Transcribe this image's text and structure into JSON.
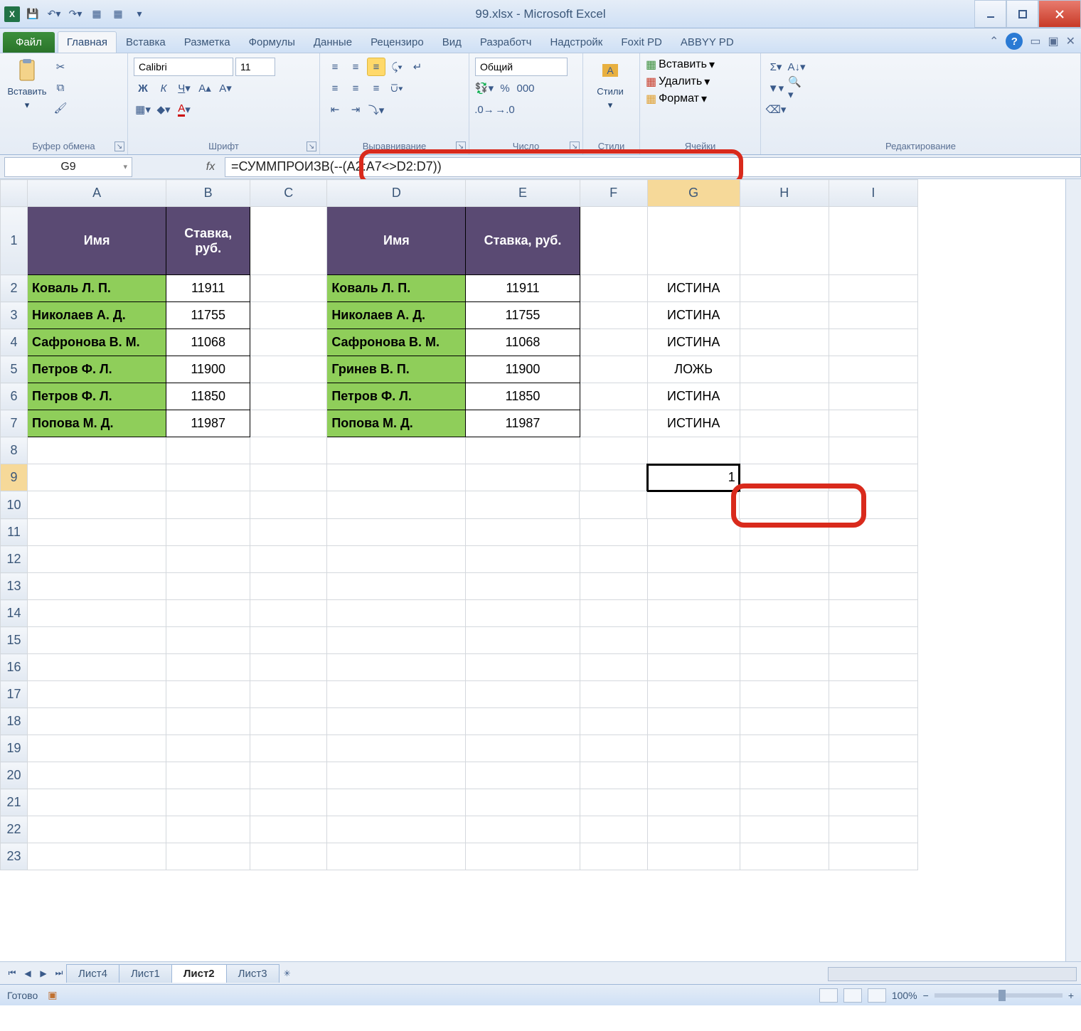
{
  "title": "99.xlsx - Microsoft Excel",
  "qat": {
    "save": "💾",
    "undo": "↶",
    "redo": "↷"
  },
  "tabs": {
    "file": "Файл",
    "items": [
      "Главная",
      "Вставка",
      "Разметка",
      "Формулы",
      "Данные",
      "Рецензиро",
      "Вид",
      "Разработч",
      "Надстройк",
      "Foxit PD",
      "ABBYY PD"
    ],
    "active": "Главная"
  },
  "ribbon": {
    "clipboard": {
      "label": "Буфер обмена",
      "paste": "Вставить"
    },
    "font": {
      "label": "Шрифт",
      "name": "Calibri",
      "size": "11"
    },
    "alignment": {
      "label": "Выравнивание"
    },
    "number": {
      "label": "Число",
      "format": "Общий"
    },
    "styles": {
      "label": "Стили",
      "btn": "Стили"
    },
    "cells": {
      "label": "Ячейки",
      "insert": "Вставить",
      "delete": "Удалить",
      "format": "Формат"
    },
    "editing": {
      "label": "Редактирование"
    }
  },
  "nameBox": "G9",
  "formula": "=СУММПРОИЗВ(--(A2:A7<>D2:D7))",
  "columns": [
    "A",
    "B",
    "C",
    "D",
    "E",
    "F",
    "G",
    "H",
    "I"
  ],
  "headers": {
    "t1_name": "Имя",
    "t1_rate": "Ставка, руб.",
    "t2_name": "Имя",
    "t2_rate": "Ставка, руб."
  },
  "table1": [
    {
      "name": "Коваль Л. П.",
      "rate": "11911"
    },
    {
      "name": "Николаев А. Д.",
      "rate": "11755"
    },
    {
      "name": "Сафронова В. М.",
      "rate": "11068"
    },
    {
      "name": "Петров Ф. Л.",
      "rate": "11900"
    },
    {
      "name": "Петров Ф. Л.",
      "rate": "11850"
    },
    {
      "name": "Попова М. Д.",
      "rate": "11987"
    }
  ],
  "table2": [
    {
      "name": "Коваль Л. П.",
      "rate": "11911"
    },
    {
      "name": "Николаев А. Д.",
      "rate": "11755"
    },
    {
      "name": "Сафронова В. М.",
      "rate": "11068"
    },
    {
      "name": "Гринев В. П.",
      "rate": "11900"
    },
    {
      "name": "Петров Ф. Л.",
      "rate": "11850"
    },
    {
      "name": "Попова М. Д.",
      "rate": "11987"
    }
  ],
  "colG": [
    "ИСТИНА",
    "ИСТИНА",
    "ИСТИНА",
    "ЛОЖЬ",
    "ИСТИНА",
    "ИСТИНА"
  ],
  "g9": "1",
  "sheets": {
    "items": [
      "Лист4",
      "Лист1",
      "Лист2",
      "Лист3"
    ],
    "active": "Лист2"
  },
  "status": {
    "ready": "Готово",
    "zoom": "100%"
  }
}
